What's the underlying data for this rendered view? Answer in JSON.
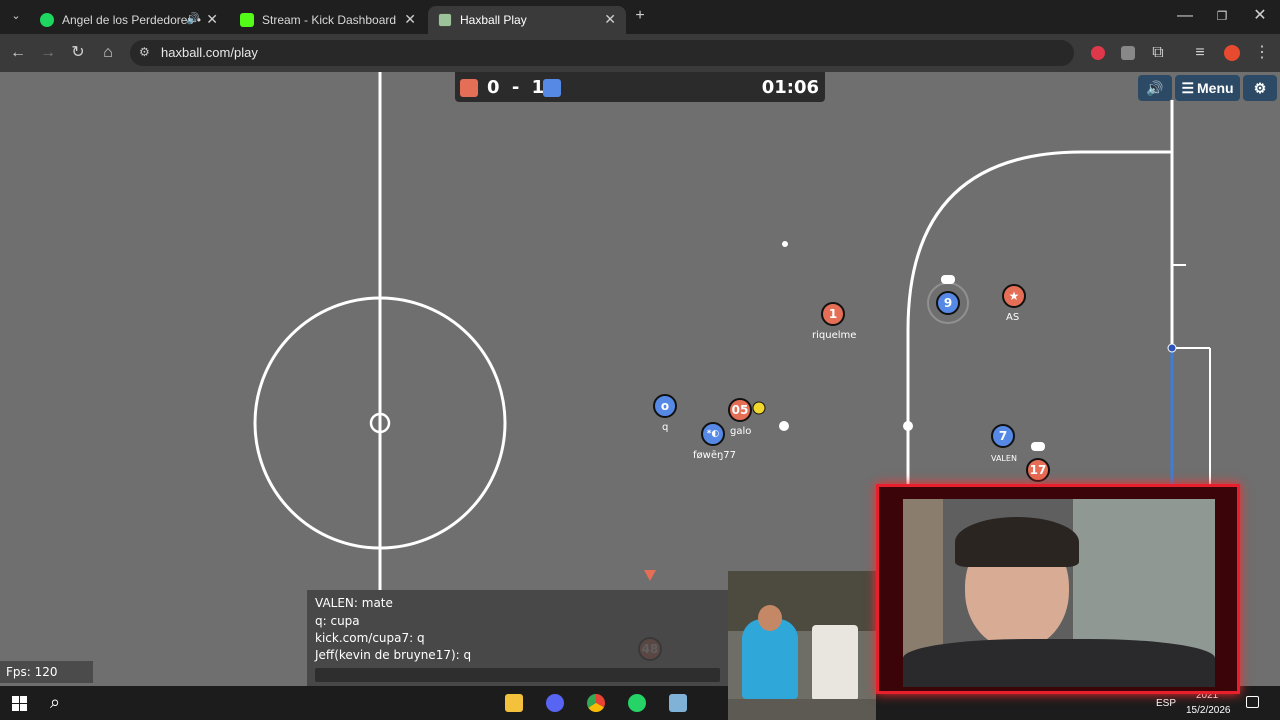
{
  "browser": {
    "tabs": [
      {
        "title": "Angel de los Perdedores • ",
        "favicon": "spotify-icon",
        "color": "#1ed760"
      },
      {
        "title": "Stream - Kick Dashboard",
        "favicon": "kick-icon",
        "color": "#53fc18"
      },
      {
        "title": "Haxball Play",
        "favicon": "haxball-icon",
        "color": "#9cc29a"
      }
    ],
    "url": "haxball.com/play"
  },
  "game": {
    "score_red": "0",
    "score_sep": "-",
    "score_blue": "1",
    "clock": "01:06",
    "menu_label": "Menu",
    "red_color": "#e56e56",
    "blue_color": "#5689e5",
    "players": [
      {
        "num": "1",
        "team": "red",
        "name": "riquelme"
      },
      {
        "num": "9",
        "team": "blue",
        "name": ""
      },
      {
        "num": "★",
        "team": "red",
        "name": "AS"
      },
      {
        "num": "o",
        "team": "blue",
        "name": "q"
      },
      {
        "num": "05",
        "team": "red",
        "name": "galo"
      },
      {
        "num": "*◐",
        "team": "blue",
        "name": "føwēŋ77"
      },
      {
        "num": "7",
        "team": "blue",
        "name": "VALEN"
      },
      {
        "num": "17",
        "team": "red",
        "name": ""
      },
      {
        "num": "48",
        "team": "red",
        "name": ""
      }
    ]
  },
  "chat": {
    "lines": [
      {
        "text": "VALEN: mate"
      },
      {
        "text": "q: cupa"
      },
      {
        "text": "kick.com/cupa7: q"
      },
      {
        "text": "Jeff(kevin de bruyne17): q"
      }
    ]
  },
  "fps_label": "Fps: 120",
  "taskbar": {
    "lang": "ESP",
    "time": "2021",
    "date": "15/2/2026"
  }
}
